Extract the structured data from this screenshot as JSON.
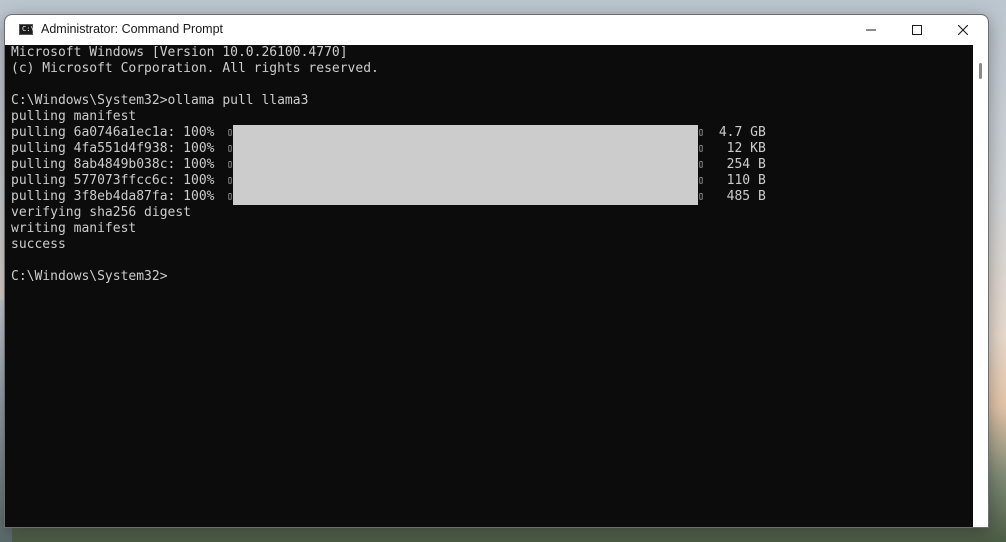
{
  "window": {
    "title": "Administrator: Command Prompt",
    "icon_glyph": "C:\\",
    "controls": {
      "minimize": "minimize-icon",
      "maximize": "maximize-icon",
      "close": "close-icon"
    }
  },
  "console": {
    "lines": [
      "Microsoft Windows [Version 10.0.26100.4770]",
      "(c) Microsoft Corporation. All rights reserved.",
      "",
      "C:\\Windows\\System32>ollama pull llama3",
      "pulling manifest"
    ],
    "pulls": [
      {
        "label": "pulling 6a0746a1ec1a: 100% ",
        "size": " 4.7 GB",
        "progress": 1.0
      },
      {
        "label": "pulling 4fa551d4f938: 100% ",
        "size": "  12 KB",
        "progress": 1.0
      },
      {
        "label": "pulling 8ab4849b038c: 100% ",
        "size": "  254 B",
        "progress": 1.0
      },
      {
        "label": "pulling 577073ffcc6c: 100% ",
        "size": "  110 B",
        "progress": 1.0
      },
      {
        "label": "pulling 3f8eb4da87fa: 100% ",
        "size": "  485 B",
        "progress": 1.0
      }
    ],
    "after": [
      "verifying sha256 digest",
      "writing manifest",
      "success",
      "",
      "C:\\Windows\\System32>"
    ],
    "box_glyph": "▯"
  },
  "colors": {
    "terminal_bg": "#0c0c0c",
    "terminal_fg": "#cccccc",
    "titlebar_bg": "#ffffff"
  }
}
